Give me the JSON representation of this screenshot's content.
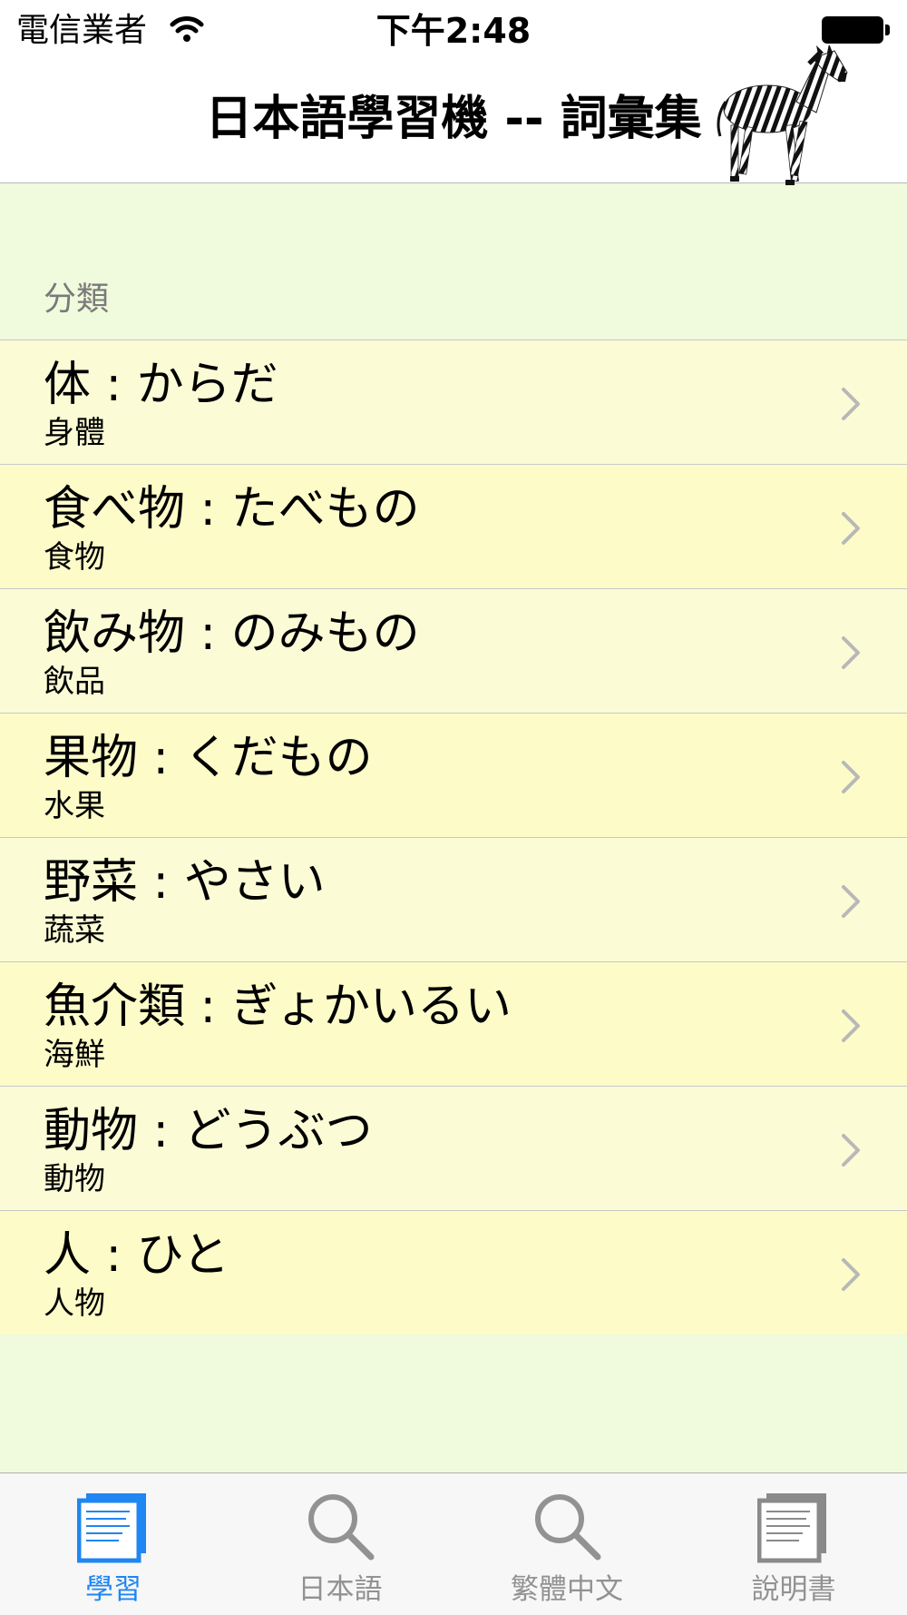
{
  "status_bar": {
    "carrier": "電信業者",
    "time": "下午2:48"
  },
  "nav": {
    "title": "日本語學習機 -- 詞彙集",
    "mascot_icon": "zebra-image"
  },
  "section": {
    "header": "分類"
  },
  "categories": [
    {
      "title": "体 : からだ",
      "subtitle": "身體"
    },
    {
      "title": "食べ物 : たべもの",
      "subtitle": "食物"
    },
    {
      "title": "飲み物 : のみもの",
      "subtitle": "飲品"
    },
    {
      "title": "果物 : くだもの",
      "subtitle": "水果"
    },
    {
      "title": "野菜 : やさい",
      "subtitle": "蔬菜"
    },
    {
      "title": "魚介類 : ぎょかいるい",
      "subtitle": "海鮮"
    },
    {
      "title": "動物 : どうぶつ",
      "subtitle": "動物"
    },
    {
      "title": "人 : ひと",
      "subtitle": "人物"
    }
  ],
  "tabs": [
    {
      "label": "學習",
      "icon": "study-card-icon",
      "active": true
    },
    {
      "label": "日本語",
      "icon": "search-icon",
      "active": false
    },
    {
      "label": "繁體中文",
      "icon": "search-icon",
      "active": false
    },
    {
      "label": "說明書",
      "icon": "manual-icon",
      "active": false
    }
  ],
  "colors": {
    "background": "#f0fadc",
    "row_odd": "#fbfcd6",
    "row_even": "#fdfbc8",
    "tab_active": "#1f86f2",
    "tab_inactive": "#929292"
  }
}
